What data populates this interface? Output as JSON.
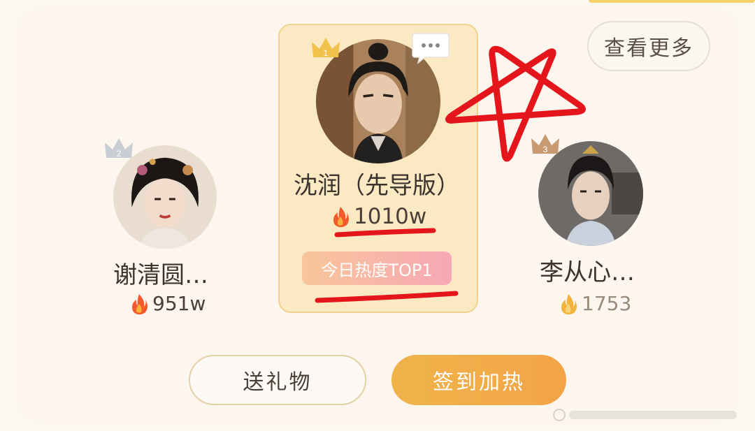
{
  "header": {
    "more_label": "查看更多"
  },
  "ranking": [
    {
      "rank": 1,
      "name": "沈润（先导版）",
      "heat": "1010w",
      "badge": "今日热度TOP1"
    },
    {
      "rank": 2,
      "name": "谢清圆…",
      "heat": "951w"
    },
    {
      "rank": 3,
      "name": "李从心…",
      "heat": "1753"
    }
  ],
  "actions": {
    "gift_label": "送礼物",
    "checkin_label": "签到加热"
  },
  "colors": {
    "accent": "#f0b34a",
    "panel": "#fbe9c3",
    "annotation_red": "#e4161b",
    "badge_gradient_start": "#f8c69a",
    "badge_gradient_end": "#f7a7b5"
  },
  "icons": {
    "crown": "crown-icon",
    "chat": "chat-bubble-icon",
    "heat": "flame-icon"
  }
}
